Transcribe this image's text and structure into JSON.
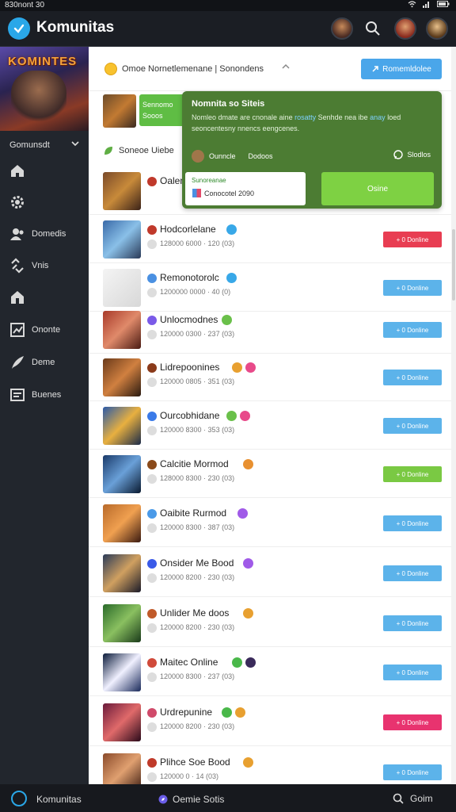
{
  "status_bar": {
    "time": "830nont 30",
    "icons": [
      "wifi-icon",
      "signal-icon",
      "battery-icon"
    ]
  },
  "app": {
    "title": "Komunitas",
    "accent": "#2aa7e8"
  },
  "sidebar": {
    "banner_text": "KOMINTES",
    "section_label": "Gomunsdt",
    "items": [
      {
        "label": "",
        "icon": "home-icon"
      },
      {
        "label": "",
        "icon": "gear-icon"
      },
      {
        "label": "Domedis",
        "icon": "users-icon"
      },
      {
        "label": "Vnis",
        "icon": "link-icon"
      },
      {
        "label": "",
        "icon": "house-icon"
      },
      {
        "label": "Ononte",
        "icon": "chart-icon"
      },
      {
        "label": "Deme",
        "icon": "feather-icon"
      },
      {
        "label": "Buenes",
        "icon": "list-icon"
      }
    ]
  },
  "topbar": {
    "text": "Omoe Nornetlemenane | Sonondens",
    "button": "Romemldolee"
  },
  "featured": {
    "tag_line1": "Sennomo",
    "tag_line2": "Sooos"
  },
  "category": {
    "label": "Soneoe Uiebe"
  },
  "popup": {
    "title": "Nomnita so Siteis",
    "desc_a": "Nomleo dmate are cnonale aine ",
    "desc_link": "rosatty",
    "desc_b": " Senhde nea ibe ",
    "desc_link2": "anay",
    "desc_c": " loed seoncentesny nnencs eengcenes.",
    "user": "Ounncle",
    "user2": "Dodoos",
    "right": "Slodlos",
    "card_line1": "Sunoreanae",
    "card_line2": "Conocotel 2090",
    "button": "Osine"
  },
  "games": [
    {
      "name": "Oalen",
      "meta": "",
      "button": "",
      "button_color": ""
    },
    {
      "name": "Hodcorlelane",
      "meta": "128000 6000 · 120 (03)",
      "button": "+ 0 Donline",
      "button_color": "#e83d52"
    },
    {
      "name": "Remonotorolc",
      "meta": "1200000 0000 · 40 (0)",
      "button": "+ 0 Donline",
      "button_color": "#5cb3ea"
    },
    {
      "name": "Unlocmodnes",
      "meta": "120000 0300 · 237 (03)",
      "button": "+ 0 Donline",
      "button_color": "#5cb3ea"
    },
    {
      "name": "Lidrepoonines",
      "meta": "120000 0805 · 351 (03)",
      "button": "+ 0 Donline",
      "button_color": "#5cb3ea"
    },
    {
      "name": "Ourcobhidane",
      "meta": "120000 8300 · 353 (03)",
      "button": "+ 0 Donline",
      "button_color": "#5cb3ea"
    },
    {
      "name": "Calcitie Mormod",
      "meta": "128000 8300 · 230 (03)",
      "button": "+ 0 Donline",
      "button_color": "#7ac943"
    },
    {
      "name": "Oaibite Rurmod",
      "meta": "120000 8300 · 387 (03)",
      "button": "+ 0 Donline",
      "button_color": "#5cb3ea"
    },
    {
      "name": "Onsider Me Bood",
      "meta": "120000 8200 · 230 (03)",
      "button": "+ 0 Donline",
      "button_color": "#5cb3ea"
    },
    {
      "name": "Unlider Me doos",
      "meta": "120000 8200 · 230 (03)",
      "button": "+ 0 Donline",
      "button_color": "#5cb3ea"
    },
    {
      "name": "Maitec Online",
      "meta": "120000 8300 · 237 (03)",
      "button": "+ 0 Donline",
      "button_color": "#5cb3ea"
    },
    {
      "name": "Urdrepunine",
      "meta": "120000 8200 · 230 (03)",
      "button": "+ 0 Donline",
      "button_color": "#e8336f"
    },
    {
      "name": "Plihce Soe Bood",
      "meta": "120000 0 · 14 (03)",
      "button": "+ 0 Donline",
      "button_color": "#5cb3ea"
    }
  ],
  "bottom": {
    "title": "Komunitas",
    "center": "Oemie Sotis",
    "right": "Goim"
  }
}
